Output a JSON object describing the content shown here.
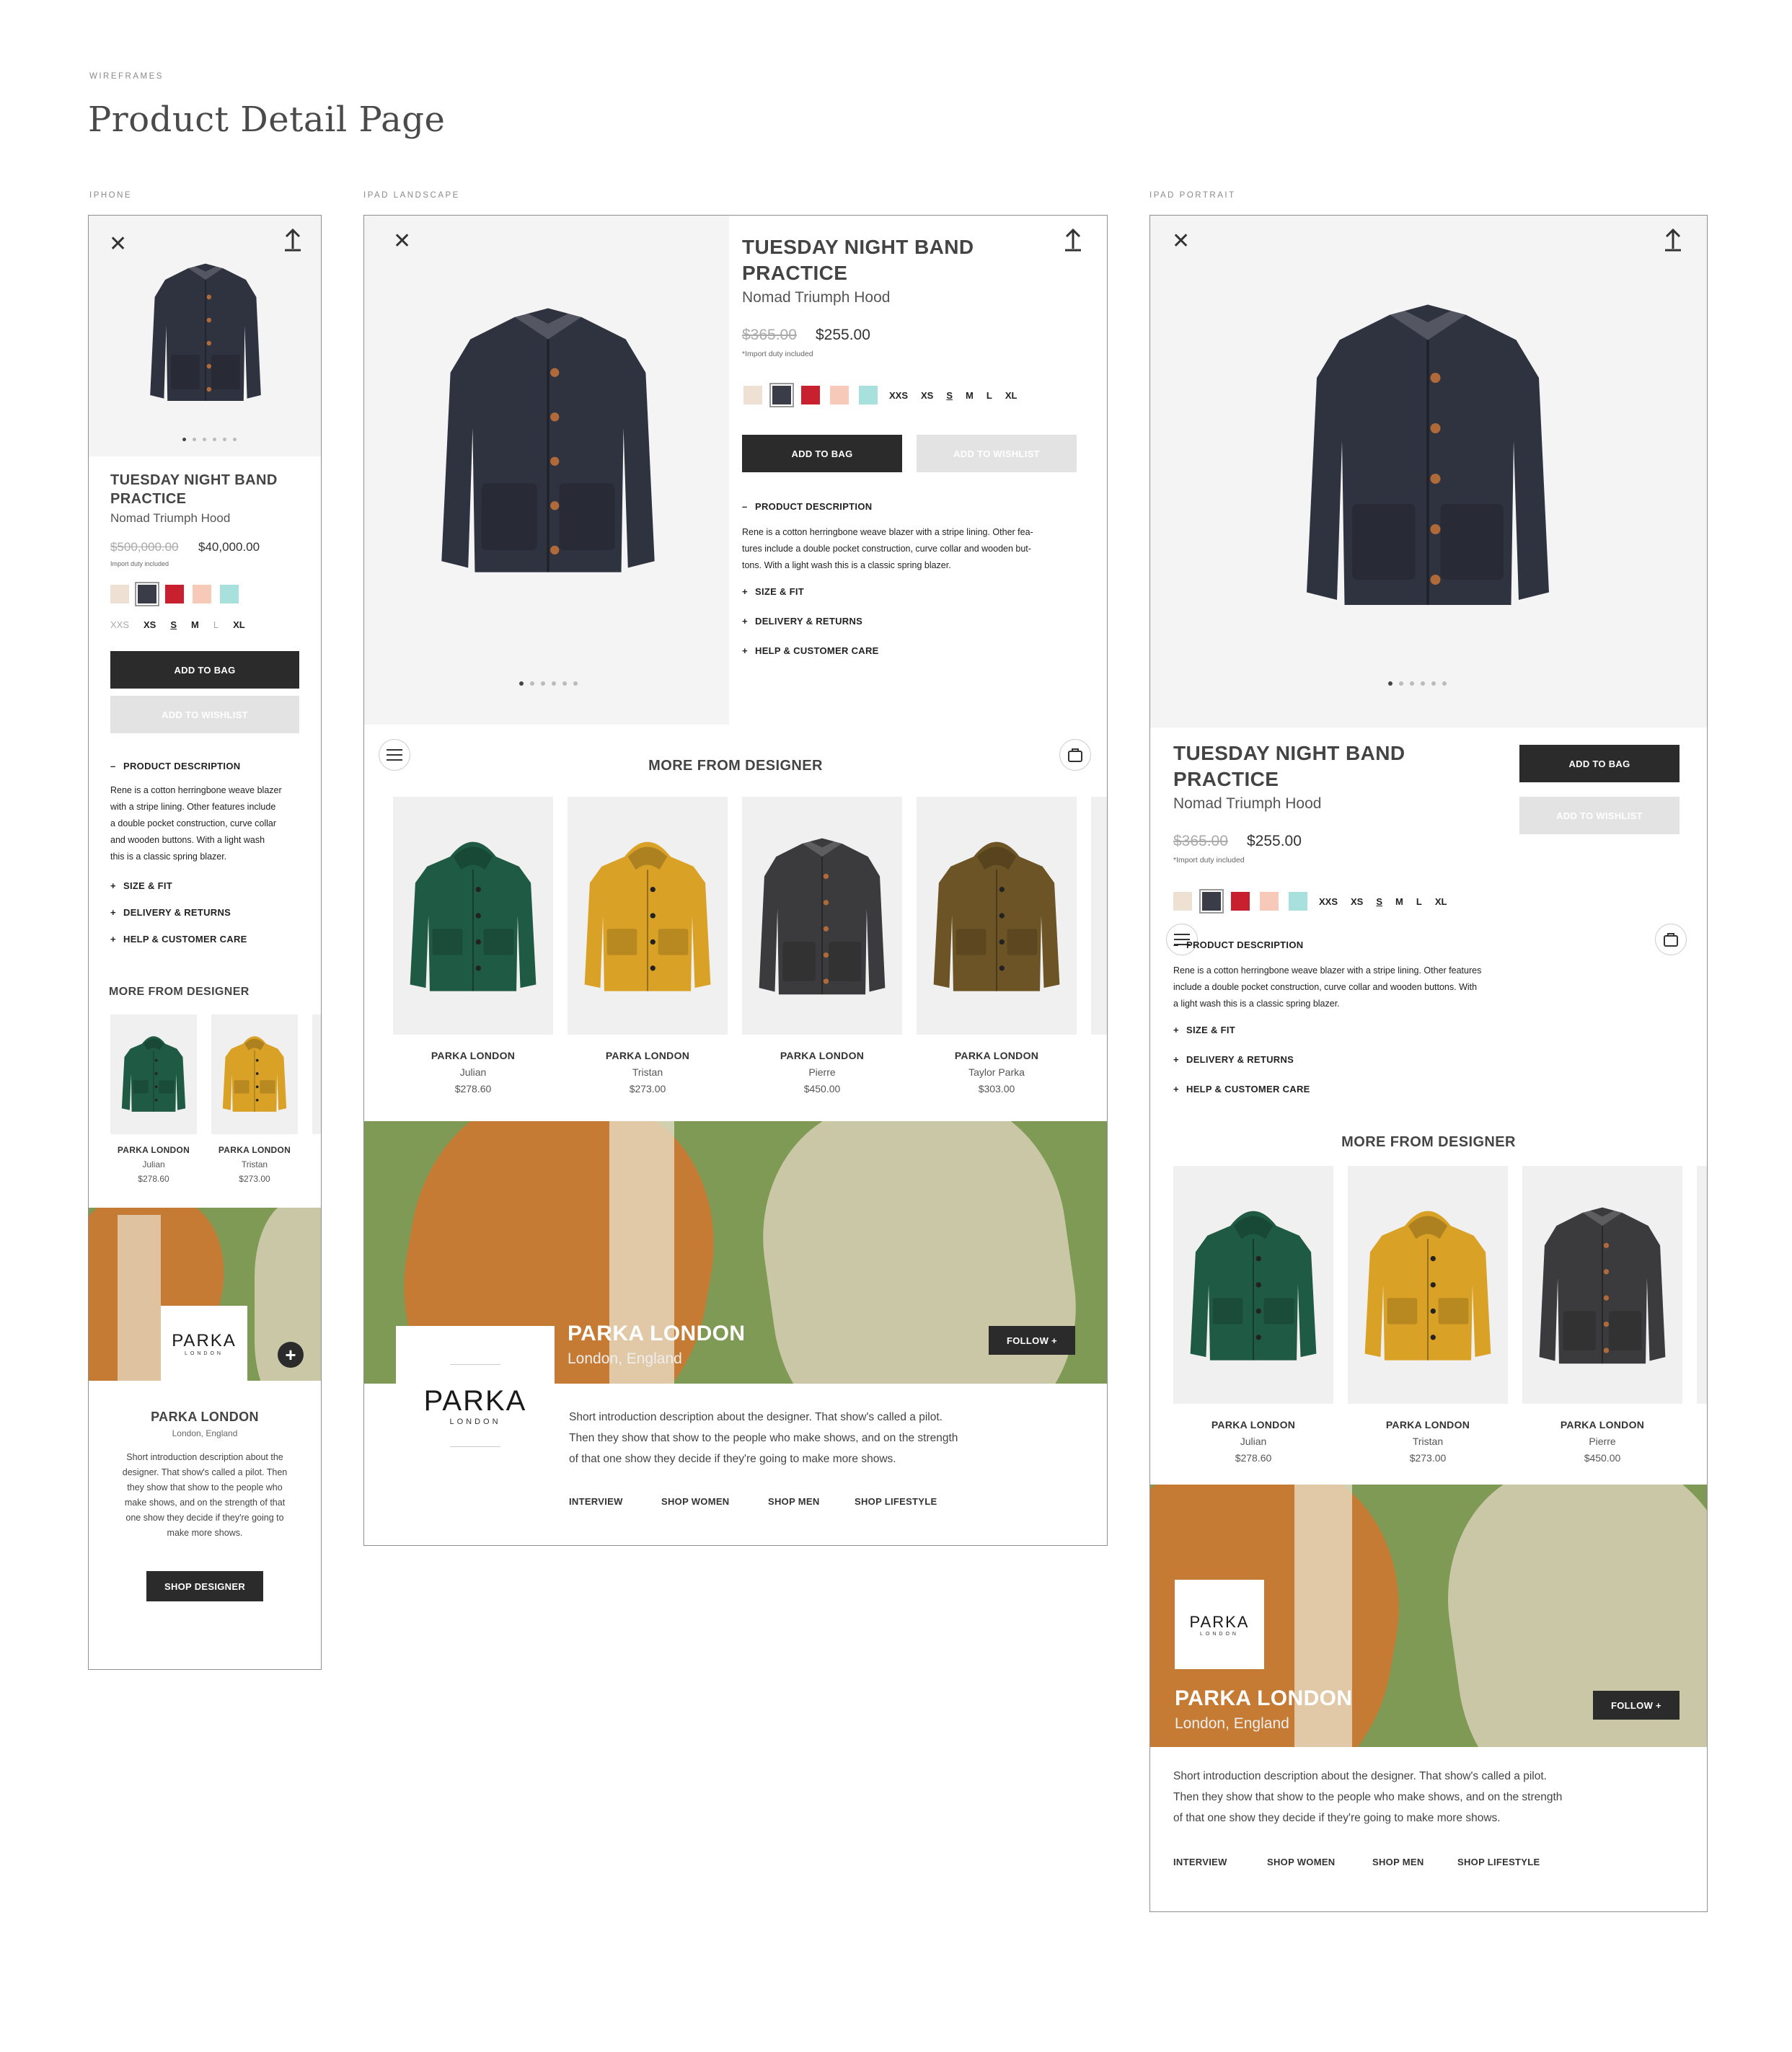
{
  "header": {
    "kicker": "WIREFRAMES",
    "title": "Product Detail Page"
  },
  "device_labels": {
    "iphone": "IPHONE",
    "ipad_landscape": "IPAD LANDSCAPE",
    "ipad_portrait": "IPAD PORTRAIT"
  },
  "product": {
    "title": "TUESDAY NIGHT BAND PRACTICE",
    "subtitle": "Nomad Triumph Hood",
    "iphone_old_price": "$500,000.00",
    "iphone_price": "$40,000.00",
    "ipad_old_price": "$365.00",
    "ipad_price": "$255.00",
    "duty_note_iphone": "Import duty included",
    "duty_note_ipad": "*Import duty included",
    "swatches": [
      "#efe0d4",
      "#3a3d48",
      "#c8202f",
      "#f7c9b8",
      "#a7e0dc"
    ],
    "sizes": [
      "XXS",
      "XS",
      "S",
      "M",
      "L",
      "XL"
    ],
    "add_to_bag": "ADD TO BAG",
    "add_to_wishlist": "ADD TO WISHLIST",
    "section_desc": "PRODUCT DESCRIPTION",
    "description": "Rene is a cotton herringbone weave blazer with a stripe lining. Other features include a double pocket construction, curve collar and wooden buttons. With a light wash this is a classic spring blazer.",
    "desc_iphone_lines": [
      "Rene is a cotton herringbone weave blazer",
      "with a stripe lining. Other features include",
      "a double pocket construction, curve collar",
      "and wooden buttons. With a light wash",
      "this is a classic spring blazer."
    ],
    "desc_land_lines": [
      "Rene is a cotton herringbone weave blazer with a stripe lining. Other fea-",
      "tures include a double pocket construction, curve collar and wooden but-",
      "tons. With a light wash this is a classic spring blazer."
    ],
    "desc_port_lines": [
      "Rene is a cotton herringbone weave blazer with a stripe lining. Other features",
      "include a double pocket construction, curve collar and wooden buttons. With",
      "a light wash this is a classic spring blazer."
    ],
    "section_size": "SIZE & FIT",
    "section_delivery": "DELIVERY & RETURNS",
    "section_help": "HELP & CUSTOMER CARE"
  },
  "more": {
    "title": "MORE FROM DESIGNER",
    "items": [
      {
        "brand": "PARKA LONDON",
        "name": "Julian",
        "price": "$278.60",
        "color": "#1f5a44"
      },
      {
        "brand": "PARKA LONDON",
        "name": "Tristan",
        "price": "$273.00",
        "color": "#d9a227"
      },
      {
        "brand": "PARKA LONDON",
        "name": "Pierre",
        "price": "$450.00",
        "color": "#3b3b3d"
      },
      {
        "brand": "PARKA LONDON",
        "name": "Taylor Parka",
        "price": "$303.00",
        "color": "#6d5426"
      }
    ]
  },
  "designer": {
    "name": "PARKA LONDON",
    "location": "London, England",
    "logo_word": "PARKA",
    "logo_sub": "LONDON",
    "follow": "FOLLOW +",
    "intro": "Short introduction description about the designer.  That show's called a pilot. Then they show that show to the people who make shows, and on the strength of that one show they decide if they're going to make more shows.",
    "intro_iphone_lines": [
      "Short introduction description about the",
      "designer.  That show's called a pilot. Then",
      "they show that show to the people who",
      "make shows, and on the strength of that",
      "one show they decide if they're going to",
      "make more shows."
    ],
    "intro_ipad_lines": [
      "Short introduction description about the designer.  That show's called a pilot.",
      "Then they show that show to the people who make shows, and on the strength",
      "of that one show they decide if they're going to make more shows."
    ],
    "shop": "SHOP DESIGNER",
    "tabs": [
      "INTERVIEW",
      "SHOP WOMEN",
      "SHOP MEN",
      "SHOP LIFESTYLE"
    ]
  }
}
